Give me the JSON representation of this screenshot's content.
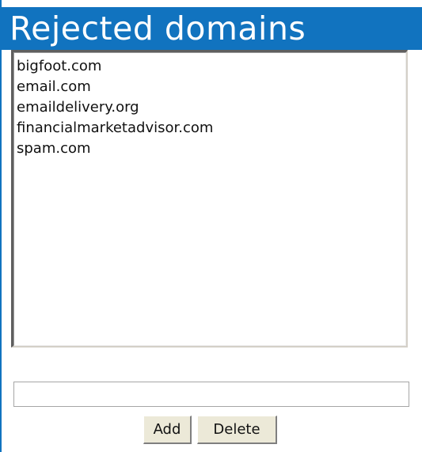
{
  "header": {
    "title": "Rejected domains"
  },
  "domains": {
    "items": [
      "bigfoot.com",
      "email.com",
      "emaildelivery.org",
      "financialmarketadvisor.com",
      "spam.com"
    ]
  },
  "new_domain": {
    "value": "",
    "placeholder": ""
  },
  "actions": {
    "add_label": "Add",
    "delete_label": "Delete"
  },
  "colors": {
    "header_background": "#1173bf",
    "header_text": "#ffffff",
    "button_face": "#ece9d8"
  }
}
